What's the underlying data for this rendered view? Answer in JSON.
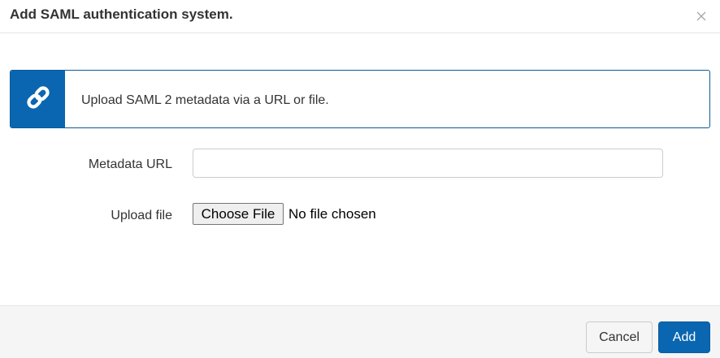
{
  "dialog": {
    "title": "Add SAML authentication system.",
    "close_icon": "close-icon"
  },
  "info": {
    "icon": "link-icon",
    "text": "Upload SAML 2 metadata via a URL or file.",
    "accent_color": "#0a66b0"
  },
  "form": {
    "metadata_url_label": "Metadata URL",
    "metadata_url_value": "",
    "upload_file_label": "Upload file",
    "choose_file_label": "Choose File",
    "file_status": "No file chosen"
  },
  "footer": {
    "cancel_label": "Cancel",
    "add_label": "Add",
    "primary_color": "#0a66b0"
  }
}
